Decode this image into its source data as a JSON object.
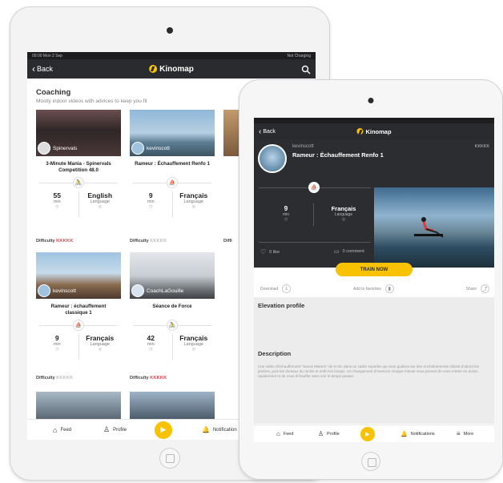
{
  "back_tablet": {
    "status": {
      "time": "09:00 Mon 2 Sep",
      "battery": "Not Charging"
    },
    "nav": {
      "back_label": "Back",
      "logo_text": "Kinomap"
    },
    "section": {
      "title": "Coaching",
      "subtitle": "Mostly indoor videos with advices to keep you fit"
    },
    "cards": [
      {
        "author": "Spinervals",
        "title": "3-Minute Mania - Spinervals Competition 48.0",
        "type_icon": "bike-icon",
        "stat1_value": "55",
        "stat1_label": "min",
        "stat2_value": "English",
        "stat2_label": "Language",
        "difficulty_label": "Difficulty",
        "difficulty_marks": "KKKKK"
      },
      {
        "author": "kevinscott",
        "title": "Rameur : Échauffement Renfo 1",
        "type_icon": "rower-icon",
        "stat1_value": "9",
        "stat1_label": "min",
        "stat2_value": "Français",
        "stat2_label": "Language",
        "difficulty_label": "Difficulty",
        "difficulty_marks": "KKKKK"
      },
      {
        "author": "kevinscott",
        "title": "Rameur : échauffement classique 1",
        "type_icon": "rower-icon",
        "stat1_value": "9",
        "stat1_label": "min",
        "stat2_value": "Français",
        "stat2_label": "Language",
        "difficulty_label": "Difficulty",
        "difficulty_marks": "KKKKK"
      },
      {
        "author": "CoachLaGouille",
        "title": "Séance de Force",
        "type_icon": "bike-icon",
        "stat1_value": "42",
        "stat1_label": "min",
        "stat2_value": "Français",
        "stat2_label": "Language",
        "difficulty_label": "Difficulty",
        "difficulty_marks": "KKKKK"
      }
    ],
    "partial_difficulty": "Diffi",
    "tabbar": {
      "feed": "Feed",
      "profile": "Profile",
      "notifications": "Notification"
    }
  },
  "front_tablet": {
    "nav": {
      "back_label": "Back",
      "logo_text": "Kinomap"
    },
    "video": {
      "author": "kevinscott",
      "title": "Rameur : Échauffement Renfo 1",
      "stat1_value": "9",
      "stat1_label": "min",
      "stat2_value": "Français",
      "stat2_label": "Language",
      "likes": "0 like",
      "comments": "0 comment",
      "difficulty_marks": "KKKKK"
    },
    "train_button": "TRAIN NOW",
    "actions": {
      "download": "Download",
      "favorites": "Add to favorites",
      "share": "Share"
    },
    "elevation_title": "Elevation profile",
    "description_title": "Description",
    "description_text": "Une vidéo d'échauffement \"Sweat Makers\" de 9 min dans un cadre superbe qui vous guidera sur des enchaînements ciblant d'abord les jambes, puis les dorsaux du rachis et enfin les biceps. Un changement d'exercice chaque minute vous permet de vous mettre en action rapidement et de vous échauffer sans voir le temps passer.",
    "tabbar": {
      "feed": "Feed",
      "profile": "Profile",
      "notifications": "Notifications",
      "more": "More"
    }
  },
  "colors": {
    "accent": "#f8c200",
    "nav_bg": "#2a2b2e",
    "difficulty_red": "#e63946",
    "difficulty_blue": "#2a6fdb",
    "difficulty_grey": "#bcbcbc"
  }
}
